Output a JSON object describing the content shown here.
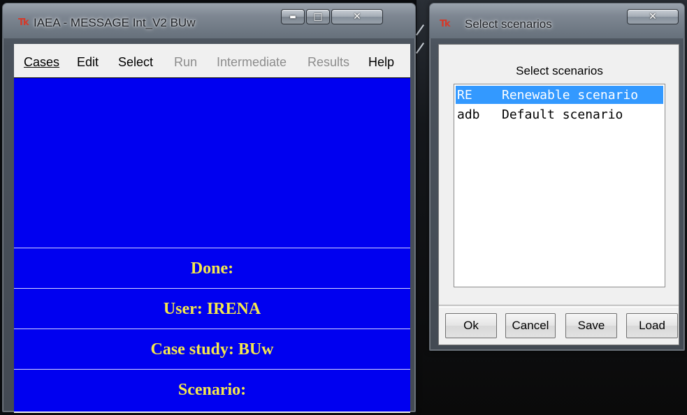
{
  "main_window": {
    "title": "IAEA - MESSAGE Int_V2 BUw",
    "title_icon": "Tk",
    "menu": [
      {
        "label": "Cases",
        "enabled": true
      },
      {
        "label": "Edit",
        "enabled": true
      },
      {
        "label": "Select",
        "enabled": true
      },
      {
        "label": "Run",
        "enabled": false
      },
      {
        "label": "Intermediate",
        "enabled": false
      },
      {
        "label": "Results",
        "enabled": false
      },
      {
        "label": "Help",
        "enabled": true
      }
    ],
    "status": {
      "done": "Done:",
      "user": "User: IRENA",
      "case_study": "Case study: BUw",
      "scenario": "Scenario:"
    },
    "colors": {
      "panel_bg": "#0000f0",
      "status_text": "#f4e84c"
    }
  },
  "dialog": {
    "title": "Select scenarios",
    "title_icon": "Tk",
    "label": "Select scenarios",
    "scenarios": [
      {
        "code": "RE",
        "name": "Renewable scenario",
        "selected": true
      },
      {
        "code": "adb",
        "name": "Default scenario",
        "selected": false
      }
    ],
    "buttons": {
      "ok": "Ok",
      "cancel": "Cancel",
      "save": "Save",
      "load": "Load"
    },
    "colors": {
      "selection": "#3399ff"
    }
  },
  "caption_glyphs": {
    "minimize": "▬",
    "maximize": "□",
    "close": "✕"
  }
}
